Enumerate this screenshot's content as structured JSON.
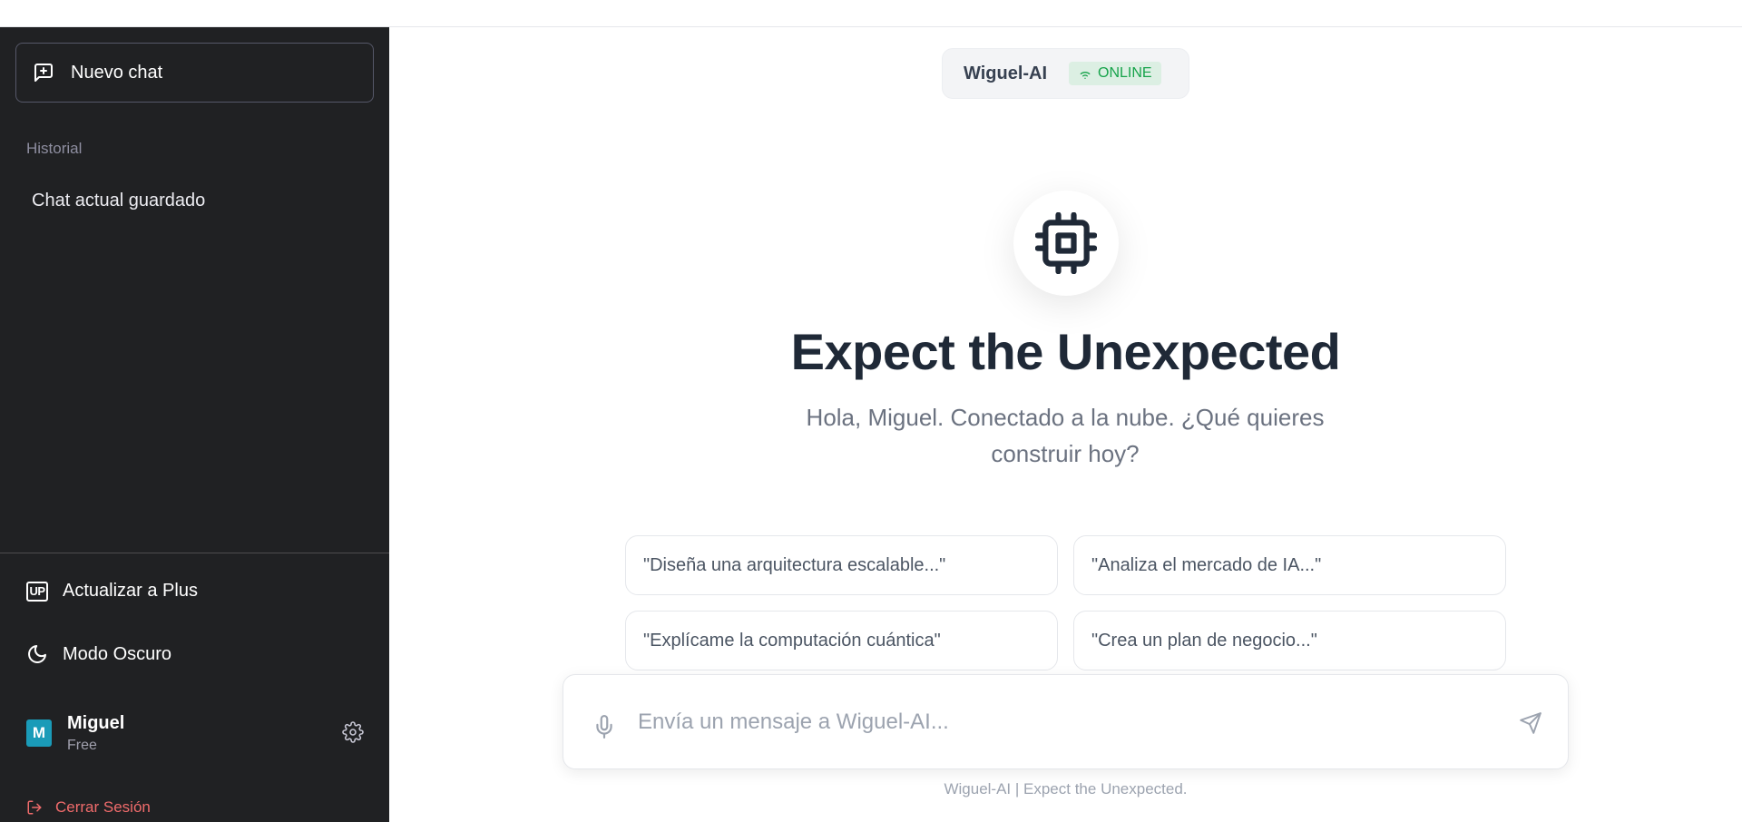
{
  "sidebar": {
    "new_chat_label": "Nuevo chat",
    "history_label": "Historial",
    "history_items": [
      {
        "label": "Chat actual guardado"
      }
    ],
    "upgrade": {
      "icon_text": "UP",
      "label": "Actualizar a Plus"
    },
    "dark_mode_label": "Modo Oscuro",
    "user": {
      "initial": "M",
      "name": "Miguel",
      "plan": "Free"
    },
    "logout_label": "Cerrar Sesión"
  },
  "header": {
    "model_name": "Wiguel-AI",
    "status": "ONLINE"
  },
  "hero": {
    "title": "Expect the Unexpected",
    "subtitle": "Hola, Miguel. Conectado a la nube. ¿Qué quieres construir hoy?"
  },
  "suggestions": [
    "\"Diseña una arquitectura escalable...\"",
    "\"Analiza el mercado de IA...\"",
    "\"Explícame la computación cuántica\"",
    "\"Crea un plan de negocio...\""
  ],
  "composer": {
    "placeholder": "Envía un mensaje a Wiguel-AI...",
    "value": ""
  },
  "footer": "Wiguel-AI | Expect the Unexpected.",
  "colors": {
    "sidebar_bg": "#202123",
    "online_green": "#16a34a",
    "avatar_bg": "#1a9bb8",
    "logout_red": "#ef6b6b"
  },
  "icons": [
    "new-chat-icon",
    "upgrade-icon",
    "moon-icon",
    "settings-icon",
    "logout-icon",
    "wifi-icon",
    "cpu-icon",
    "microphone-icon",
    "send-icon"
  ]
}
